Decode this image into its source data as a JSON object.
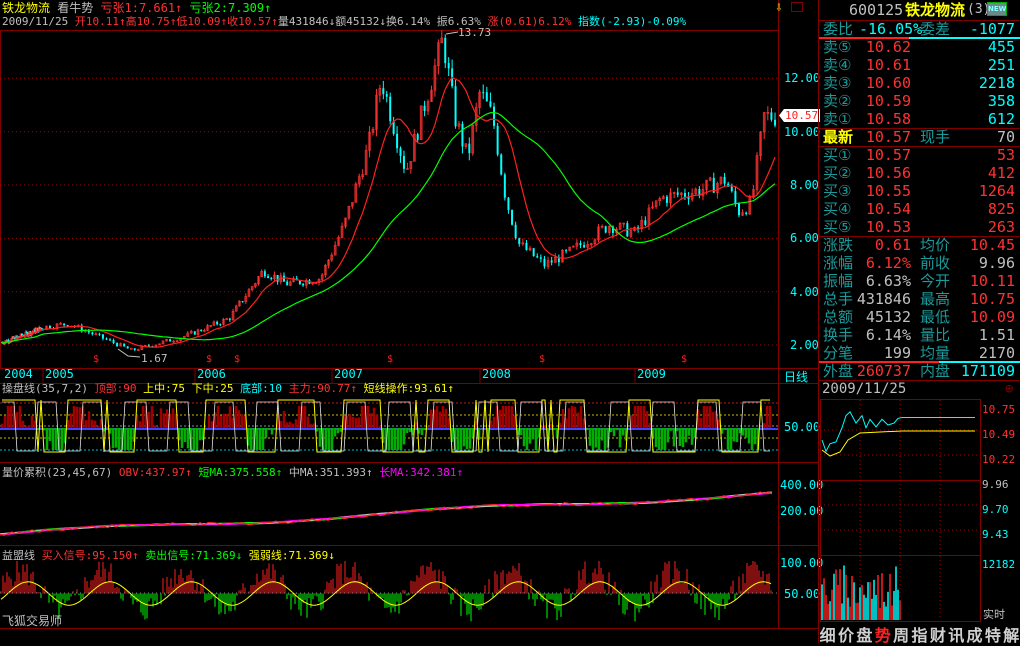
{
  "header": {
    "stock_name": "铁龙物流",
    "trend": "看牛势",
    "kz1": "亏张1:7.661",
    "kz2": "亏张2:7.309",
    "date": "2009/11/25",
    "open": "开10.11",
    "high": "高10.75",
    "low": "低10.09",
    "close": "收10.57",
    "volume": "量431846",
    "amount": "额45132",
    "turnover": "换6.14%",
    "amplitude": "振6.63%",
    "change": "涨(0.61)6.12%",
    "index": "指数(-2.93)-0.09%"
  },
  "main_chart": {
    "y_ticks": [
      "12.00",
      "10.00",
      "8.00",
      "6.00",
      "4.00",
      "2.00"
    ],
    "y_tick_values": [
      12,
      10,
      8,
      6,
      4,
      2
    ],
    "x_labels": [
      "2004",
      "2005",
      "2006",
      "2007",
      "2008",
      "2009"
    ],
    "period": "日线",
    "last_price_tag": "10.57",
    "high_marker": "13.73",
    "low_marker": "1.67",
    "price_path": [
      [
        "2004-01",
        2.1
      ],
      [
        "2004-06",
        2.3
      ],
      [
        "2004-12",
        2.6
      ],
      [
        "2005-03",
        2.8
      ],
      [
        "2005-06",
        2.2
      ],
      [
        "2005-08",
        1.8
      ],
      [
        "2005-12",
        2.3
      ],
      [
        "2006-04",
        3.0
      ],
      [
        "2006-07",
        4.8
      ],
      [
        "2006-09",
        4.3
      ],
      [
        "2006-12",
        4.5
      ],
      [
        "2007-02",
        6.5
      ],
      [
        "2007-04",
        9.5
      ],
      [
        "2007-05",
        12.0
      ],
      [
        "2007-07",
        8.5
      ],
      [
        "2007-10",
        13.5
      ],
      [
        "2007-11",
        10.5
      ],
      [
        "2007-12",
        9.0
      ],
      [
        "2008-01",
        11.5
      ],
      [
        "2008-02",
        10.5
      ],
      [
        "2008-03",
        7.5
      ],
      [
        "2008-04",
        5.8
      ],
      [
        "2008-06",
        5.0
      ],
      [
        "2008-08",
        5.5
      ],
      [
        "2008-11",
        6.5
      ],
      [
        "2009-01",
        6.2
      ],
      [
        "2009-03",
        7.5
      ],
      [
        "2009-06",
        7.8
      ],
      [
        "2009-08",
        8.2
      ],
      [
        "2009-09",
        7.0
      ],
      [
        "2009-10",
        7.3
      ],
      [
        "2009-11",
        10.57
      ]
    ],
    "colors": {
      "up": "#ff3232",
      "down": "#00ffff",
      "ma_short": "#ff2020",
      "ma_long": "#00ff00"
    }
  },
  "indicators": {
    "hpx": {
      "name": "操盘线(35,7,2)",
      "top": "顶部:90",
      "upper": "上中:75",
      "lower": "下中:25",
      "bottom": "底部:10",
      "main": "主力:90.77↑",
      "short": "短线操作:93.61↑",
      "axis": "50.00"
    },
    "obv": {
      "name": "量价累积(23,45,67)",
      "obv": "OBV:437.97↑",
      "short_ma": "短MA:375.558↑",
      "mid_ma": "中MA:351.393↑",
      "long_ma": "长MA:342.381↑",
      "axis": [
        "400.00",
        "200.00"
      ]
    },
    "ymx": {
      "name": "益盟线",
      "buy": "买入信号:95.150↑",
      "sell": "卖出信号:71.369↓",
      "strength": "强弱线:71.369↓",
      "axis": [
        "100.00",
        "50.00"
      ]
    }
  },
  "watermark": "飞狐交易师",
  "quote": {
    "code": "600125",
    "name": "铁龙物流",
    "suffix": "(3)",
    "new_badge": "NEW",
    "weibi_label": "委比",
    "weibi": "-16.05%",
    "weicha_label": "委差",
    "weicha": "-1077",
    "sells": [
      {
        "label": "卖⑤",
        "price": "10.62",
        "vol": "455"
      },
      {
        "label": "卖④",
        "price": "10.61",
        "vol": "251"
      },
      {
        "label": "卖③",
        "price": "10.60",
        "vol": "2218"
      },
      {
        "label": "卖②",
        "price": "10.59",
        "vol": "358"
      },
      {
        "label": "卖①",
        "price": "10.58",
        "vol": "612"
      }
    ],
    "last_label": "最新",
    "last": "10.57",
    "now_hand_label": "现手",
    "now_hand": "70",
    "buys": [
      {
        "label": "买①",
        "price": "10.57",
        "vol": "53"
      },
      {
        "label": "买②",
        "price": "10.56",
        "vol": "412"
      },
      {
        "label": "买③",
        "price": "10.55",
        "vol": "1264"
      },
      {
        "label": "买④",
        "price": "10.54",
        "vol": "825"
      },
      {
        "label": "买⑤",
        "price": "10.53",
        "vol": "263"
      }
    ],
    "stats": [
      {
        "l1": "涨跌",
        "v1": "0.61",
        "c1": "r",
        "l2": "均价",
        "v2": "10.45",
        "c2": "r"
      },
      {
        "l1": "涨幅",
        "v1": "6.12%",
        "c1": "r",
        "l2": "前收",
        "v2": "9.96",
        "c2": "w"
      },
      {
        "l1": "振幅",
        "v1": "6.63%",
        "c1": "w",
        "l2": "今开",
        "v2": "10.11",
        "c2": "r"
      },
      {
        "l1": "总手",
        "v1": "431846",
        "c1": "w",
        "l2": "最高",
        "v2": "10.75",
        "c2": "r"
      },
      {
        "l1": "总额",
        "v1": "45132",
        "c1": "w",
        "l2": "最低",
        "v2": "10.09",
        "c2": "r"
      },
      {
        "l1": "换手",
        "v1": "6.14%",
        "c1": "w",
        "l2": "量比",
        "v2": "1.51",
        "c2": "w"
      },
      {
        "l1": "分笔",
        "v1": "199",
        "c1": "w",
        "l2": "均量",
        "v2": "2170",
        "c2": "w"
      }
    ],
    "outer_label": "外盘",
    "outer": "260737",
    "inner_label": "内盘",
    "inner": "171109",
    "outer_ratio": 0.6
  },
  "intraday": {
    "date": "2009/11/25",
    "price_ticks": [
      "10.75",
      "10.49",
      "10.22",
      "9.96",
      "9.70",
      "9.43"
    ],
    "vol_max": "12182",
    "mode": "实时"
  },
  "tabs": [
    "细",
    "价",
    "盘",
    "势",
    "周",
    "指",
    "财",
    "讯",
    "成",
    "特",
    "解"
  ],
  "active_tab": 3
}
